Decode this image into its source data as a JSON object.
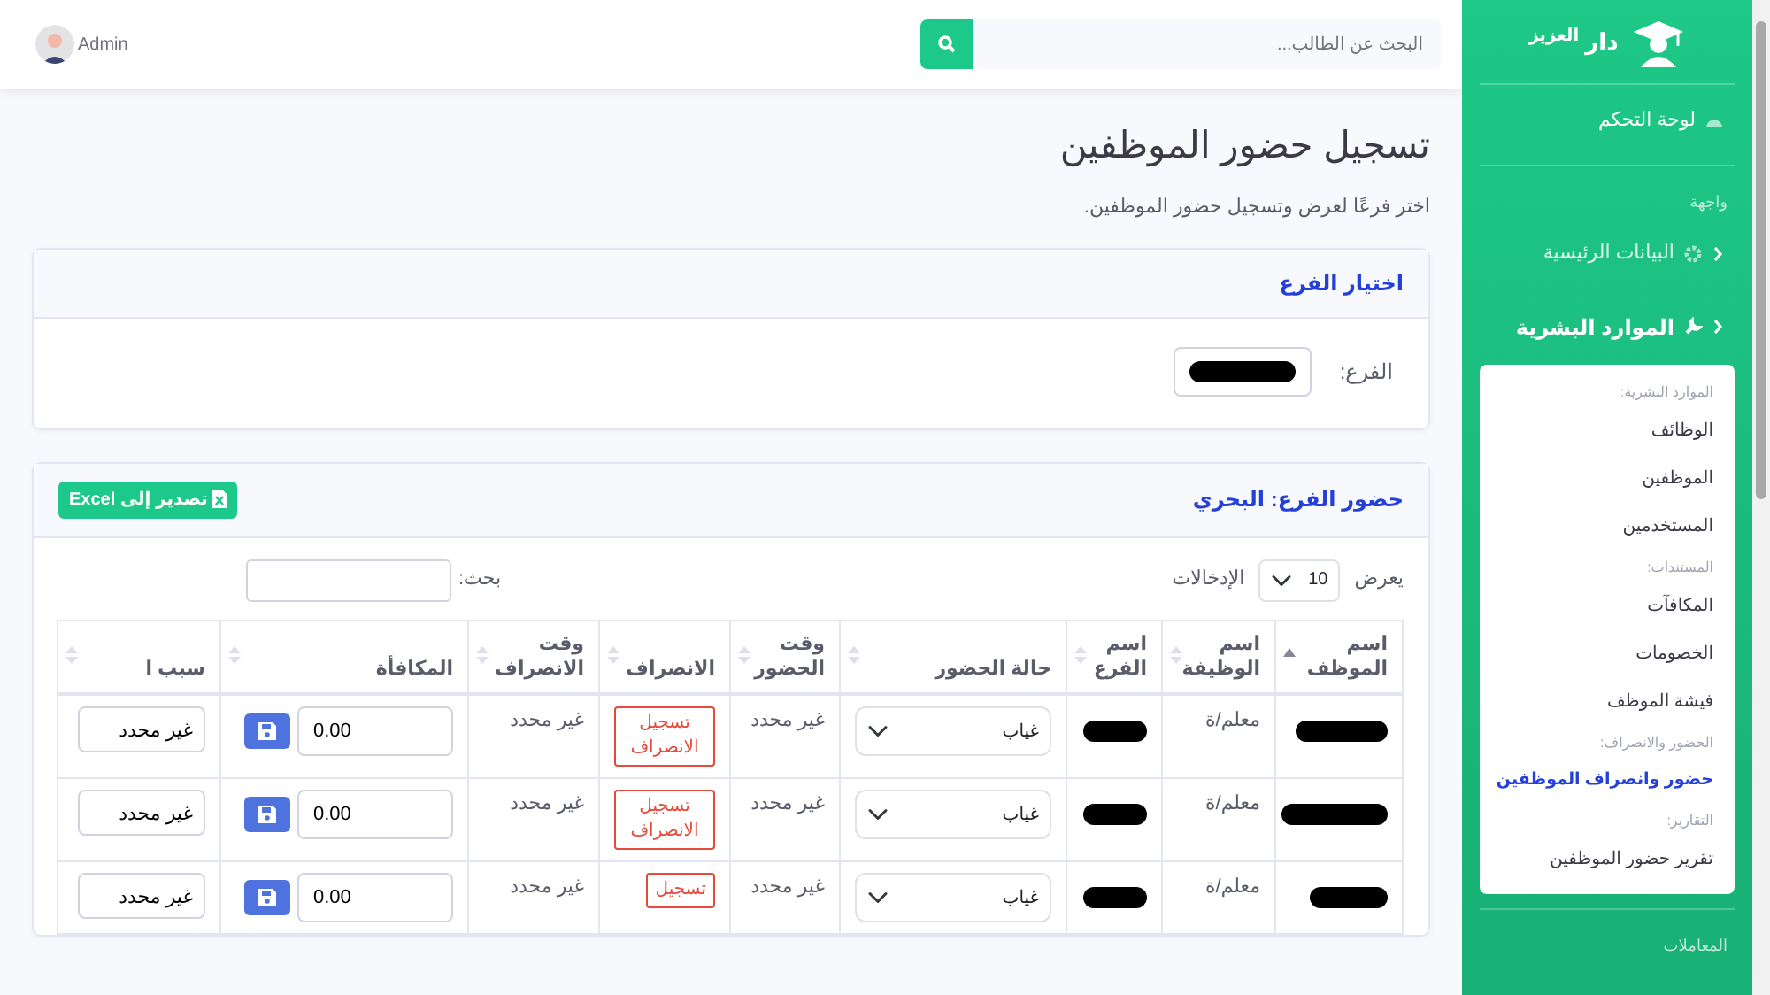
{
  "topbar": {
    "search": {
      "placeholder": "البحث عن الطالب..."
    },
    "user": {
      "name": "Admin"
    }
  },
  "sidebar": {
    "brand": "دار $^{العزيز}$",
    "dashboard": {
      "label": "لوحة التحكم"
    },
    "sections": [
      {
        "heading": "واجهة",
        "items": [
          {
            "label": "البيانات الرئيسية",
            "expanded": false
          },
          {
            "label": "الموارد البشرية",
            "expanded": true,
            "submenu": [
              {
                "heading": "الموارد البشرية:",
                "links": [
                  {
                    "label": "الوظائف",
                    "selected": false
                  },
                  {
                    "label": "الموظفين",
                    "selected": false
                  },
                  {
                    "label": "المستخدمين",
                    "selected": false
                  }
                ]
              },
              {
                "heading": "المستندات:",
                "links": [
                  {
                    "label": "المكافآت",
                    "selected": false
                  },
                  {
                    "label": "الخصومات",
                    "selected": false
                  },
                  {
                    "label": "فيشة الموظف",
                    "selected": false
                  }
                ]
              },
              {
                "heading": "الحضور والانصراف:",
                "links": [
                  {
                    "label": "حضور وانصراف الموظفين",
                    "selected": true
                  }
                ]
              },
              {
                "heading": "التقارير:",
                "links": [
                  {
                    "label": "تقرير حضور الموظفين",
                    "selected": false
                  }
                ]
              }
            ]
          }
        ]
      },
      {
        "heading": "المعاملات"
      }
    ]
  },
  "page": {
    "title": "تسجيل حضور الموظفين",
    "subtitle": "اختر فرعًا لعرض وتسجيل حضور الموظفين."
  },
  "branch_card": {
    "title": "اختيار الفرع",
    "label": "الفرع:"
  },
  "attendance_card": {
    "title": "حضور الفرع: البحري",
    "export_button": "تصدير إلى Excel",
    "length_before": "يعرض",
    "length_value": "10",
    "length_after": "الإدخالات",
    "search_label": "بحث:"
  },
  "table": {
    "columns": [
      {
        "label": "اسم الموظف",
        "sorted": true
      },
      {
        "label": "اسم الوظيفة",
        "sorted": false
      },
      {
        "label": "اسم الفرع",
        "sorted": false
      },
      {
        "label": "حالة الحضور",
        "sorted": false
      },
      {
        "label": "وقت الحضور",
        "sorted": false
      },
      {
        "label": "الانصراف",
        "sorted": false
      },
      {
        "label": "وقت الانصراف",
        "sorted": false
      },
      {
        "label": "المكافأة",
        "sorted": false
      },
      {
        "label": "سبب ا",
        "sorted": false
      }
    ],
    "rows": [
      {
        "job": "معلم/ة",
        "status": "غياب",
        "check_in": "غير محدد",
        "checkout_button": "تسجيل الانصراف",
        "checkout_time": "غير محدد",
        "bonus": "0.00",
        "reason": "غير محدد"
      },
      {
        "job": "معلم/ة",
        "status": "غياب",
        "check_in": "غير محدد",
        "checkout_button": "تسجيل الانصراف",
        "checkout_time": "غير محدد",
        "bonus": "0.00",
        "reason": "غير محدد"
      },
      {
        "job": "معلم/ة",
        "status": "غياب",
        "check_in": "غير محدد",
        "checkout_button": "تسجيل",
        "checkout_time": "غير محدد",
        "bonus": "0.00",
        "reason": "غير محدد"
      }
    ]
  }
}
